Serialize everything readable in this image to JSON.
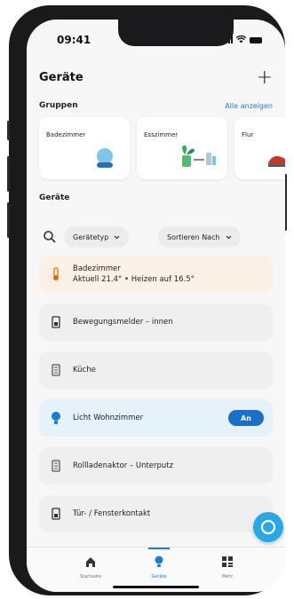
{
  "status": {
    "time": "09:41"
  },
  "header": {
    "title": "Geräte",
    "add_icon": "plus-icon"
  },
  "groups": {
    "heading": "Gruppen",
    "show_all": "Alle anzeigen",
    "items": [
      {
        "label": "Badezimmer",
        "icon": "smart-speaker-icon"
      },
      {
        "label": "Esszimmer",
        "icon": "plant-devices-icon"
      },
      {
        "label": "Flur",
        "icon": "shoe-icon"
      }
    ]
  },
  "devices": {
    "heading": "Geräte",
    "filters": {
      "type": "Gerätetyp",
      "sort": "Sortieren Nach"
    },
    "items": [
      {
        "name": "Badezimmer",
        "detail": "Aktuell 21.4° • Heizen auf 16.5°",
        "icon": "thermostat-icon",
        "state": "alert"
      },
      {
        "name": "Bewegungsmelder – innen",
        "icon": "sensor-icon"
      },
      {
        "name": "Küche",
        "icon": "device-icon"
      },
      {
        "name": "Licht Wohnzimmer",
        "icon": "lightbulb-icon",
        "state": "on",
        "toggle": "An"
      },
      {
        "name": "Rollladenaktor – Unterputz",
        "icon": "device-icon"
      },
      {
        "name": "Tür- / Fensterkontakt",
        "icon": "sensor-icon"
      }
    ]
  },
  "tabs": [
    {
      "label": "Startseite",
      "icon": "home-icon"
    },
    {
      "label": "Geräte",
      "icon": "lightbulb-icon",
      "selected": true
    },
    {
      "label": "Mehr",
      "icon": "grid-icon"
    }
  ],
  "colors": {
    "accent": "#1e7bd6",
    "toggle": "#1b6fc8",
    "alert_text": "#e0671a",
    "fab": "#2aa7e6"
  }
}
